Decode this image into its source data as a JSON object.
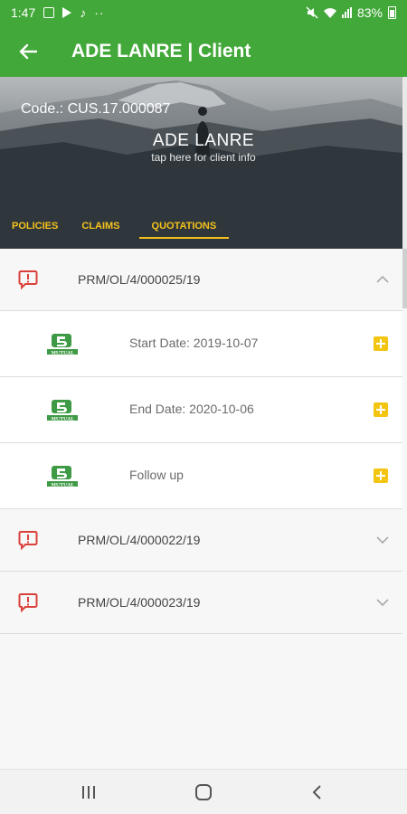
{
  "status_bar": {
    "time": "1:47",
    "battery": "83%",
    "icons": [
      "gallery-icon",
      "play-store-icon",
      "music-note-icon",
      "more-dots-icon",
      "mute-icon",
      "wifi-icon",
      "signal-icon",
      "battery-icon"
    ]
  },
  "app_bar": {
    "title": "ADE LANRE | Client",
    "back_icon": "arrow-back-icon",
    "color": "#43a83a"
  },
  "client_header": {
    "code": "Code.: CUS.17.000087",
    "name": "ADE LANRE",
    "hint": "tap here for client info"
  },
  "tabs": [
    {
      "label": "POLICIES",
      "active": false
    },
    {
      "label": "CLAIMS",
      "active": false
    },
    {
      "label": "QUOTATIONS",
      "active": true
    }
  ],
  "quotations": [
    {
      "number": "PRM/OL/4/000025/19",
      "expanded": true,
      "items": [
        {
          "label": "Start Date: 2019-10-07"
        },
        {
          "label": "End Date: 2020-10-06"
        },
        {
          "label": "Follow up"
        }
      ]
    },
    {
      "number": "PRM/OL/4/000022/19",
      "expanded": false
    },
    {
      "number": "PRM/OL/4/000023/19",
      "expanded": false
    }
  ],
  "colors": {
    "accent": "#f4c21b",
    "alert": "#d9413a",
    "brand_green": "#43a83a"
  },
  "nav_bar": {
    "recents_icon": "recents-icon",
    "home_icon": "home-icon",
    "back_icon": "back-chevron-icon"
  }
}
